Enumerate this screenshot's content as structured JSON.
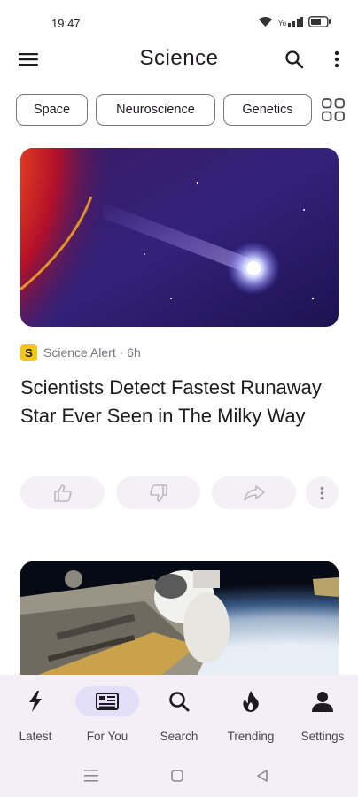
{
  "status_bar": {
    "time": "19:47",
    "icons": [
      "wifi-icon",
      "signal-icon",
      "battery-icon"
    ]
  },
  "app_bar": {
    "title": "Science",
    "left_icon": "menu-icon",
    "right_icons": [
      "search-icon",
      "more-vertical-icon"
    ]
  },
  "chips": {
    "items": [
      {
        "label": "Space"
      },
      {
        "label": "Neuroscience"
      },
      {
        "label": "Genetics"
      }
    ],
    "grid_icon": "grid-icon"
  },
  "articles": [
    {
      "source_logo": "S",
      "source": "Science Alert · 6h",
      "headline": "Scientists Detect Fastest Runaway Star Ever Seen in The Milky Way",
      "actions": [
        "thumb-up-icon",
        "thumb-down-icon",
        "share-icon",
        "more-vertical-icon"
      ]
    },
    {
      "image": "astronaut-spacewalk-image"
    }
  ],
  "bottom_nav": {
    "items": [
      {
        "label": "Latest",
        "icon": "lightning-icon",
        "active": false
      },
      {
        "label": "For You",
        "icon": "newspaper-icon",
        "active": true
      },
      {
        "label": "Search",
        "icon": "search-icon",
        "active": false
      },
      {
        "label": "Trending",
        "icon": "flame-icon",
        "active": false
      },
      {
        "label": "Settings",
        "icon": "person-icon",
        "active": false
      }
    ]
  },
  "system_nav": [
    "recents-icon",
    "home-icon",
    "back-icon"
  ],
  "colors": {
    "active_indicator": "#e4dff8",
    "nav_background": "#f4eff6",
    "source_logo": "#f5c518"
  }
}
